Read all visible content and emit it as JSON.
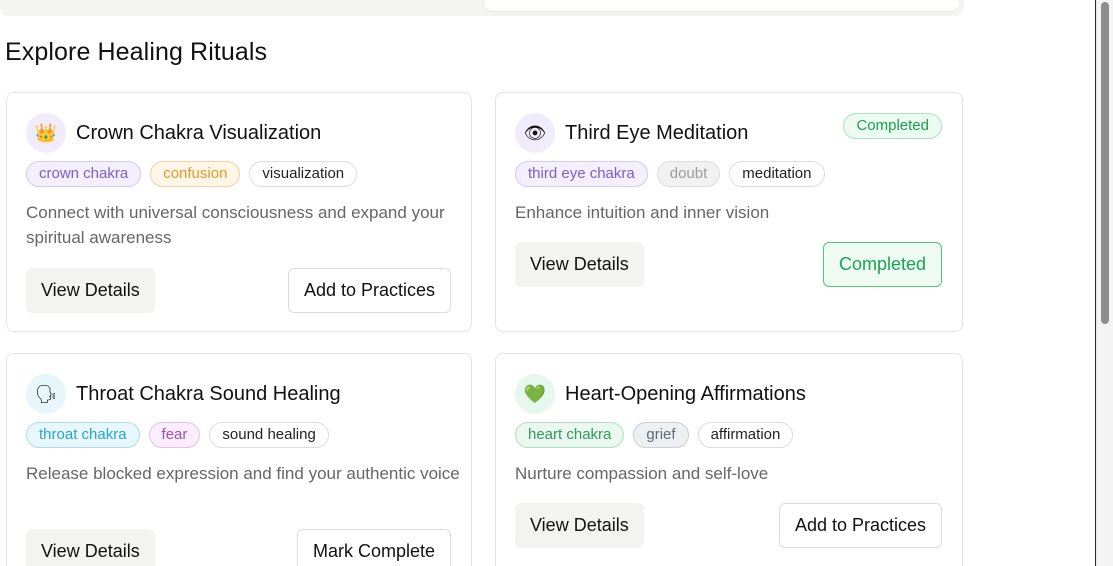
{
  "section_title": "Explore Healing Rituals",
  "colors": {
    "completed_green": "#18a553",
    "completed_border": "#4fc97b"
  },
  "rituals": [
    {
      "title": "Crown Chakra Visualization",
      "icon": "crown-emoji",
      "icon_glyph": "👑",
      "tags": [
        "crown chakra",
        "confusion",
        "visualization"
      ],
      "description": "Connect with universal consciousness and expand your spiritual awareness",
      "view_label": "View Details",
      "action_label": "Add to Practices"
    },
    {
      "title": "Third Eye Meditation",
      "icon": "eye-emoji",
      "icon_glyph": "👁",
      "status_badge": "Completed",
      "tags": [
        "third eye chakra",
        "doubt",
        "meditation"
      ],
      "description": "Enhance intuition and inner vision",
      "view_label": "View Details",
      "action_label": "Completed"
    },
    {
      "title": "Throat Chakra Sound Healing",
      "icon": "speaking-head-emoji",
      "icon_glyph": "🗣",
      "tags": [
        "throat chakra",
        "fear",
        "sound healing"
      ],
      "description": "Release blocked expression and find your authentic voice",
      "view_label": "View Details",
      "action_label": "Mark Complete"
    },
    {
      "title": "Heart-Opening Affirmations",
      "icon": "green-heart-emoji",
      "icon_glyph": "💚",
      "tags": [
        "heart chakra",
        "grief",
        "affirmation"
      ],
      "description": "Nurture compassion and self-love",
      "view_label": "View Details",
      "action_label": "Add to Practices"
    }
  ]
}
